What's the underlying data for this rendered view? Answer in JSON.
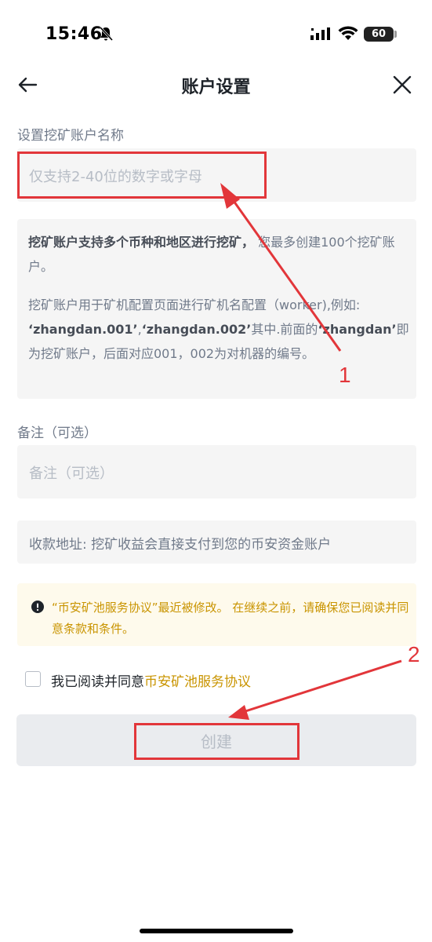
{
  "status_bar": {
    "time": "15:46",
    "battery": "60"
  },
  "header": {
    "title": "账户设置"
  },
  "account_name": {
    "label": "设置挖矿账户名称",
    "placeholder": "仅支持2-40位的数字或字母"
  },
  "info": {
    "p1_bold": "挖矿账户支持多个币种和地区进行挖矿，",
    "p1_rest": " 您最多创建100个挖矿账户。",
    "p2_a": "挖矿账户用于矿机配置页面进行矿机名配置（worker),例如: ",
    "p2_b1": "‘zhangdan.001’",
    "p2_c": ",",
    "p2_b2": "‘zhangdan.002’",
    "p2_d": "其中.前面的",
    "p2_b3": "‘zhangdan’",
    "p2_e": "即为挖矿账户，后面对应001，002为对机器的编号。"
  },
  "remark": {
    "label": "备注（可选）",
    "placeholder": "备注（可选）"
  },
  "payout": {
    "text": "收款地址: 挖矿收益会直接支付到您的币安资金账户"
  },
  "warning": {
    "text": "“币安矿池服务协议”最近被修改。 在继续之前，请确保您已阅读并同意条款和条件。"
  },
  "agreement": {
    "prefix": "我已阅读并同意",
    "link": "币安矿池服务协议",
    "checked": false
  },
  "create_button": {
    "label": "创建"
  },
  "annotations": {
    "marker_1": "1",
    "marker_2": "2"
  },
  "colors": {
    "accent": "#c99400",
    "annotation": "#e2363a",
    "warning_bg": "#fefaec"
  }
}
